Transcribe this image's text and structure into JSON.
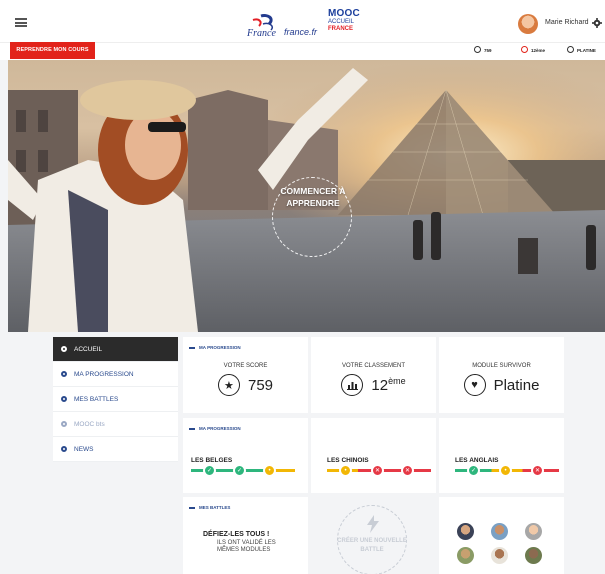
{
  "header": {
    "logo_france_text": "France",
    "logo_france_site": "france.fr",
    "logo_mooc": "MOOC",
    "logo_accueil": "ACCUEIL",
    "logo_country": "FRANCE",
    "user_name": "Marie Richard"
  },
  "subbar": {
    "resume_label": "REPRENDRE MON COURS",
    "stats": [
      {
        "label": "759",
        "icon": "star-icon"
      },
      {
        "label": "12ème",
        "icon": "chart-icon"
      },
      {
        "label": "PLATINE",
        "icon": "heart-icon"
      }
    ]
  },
  "hero": {
    "cta": "COMMENCER À APPRENDRE"
  },
  "sidebar": {
    "items": [
      {
        "label": "ACCUEIL",
        "state": "active"
      },
      {
        "label": "MA PROGRESSION",
        "state": "normal"
      },
      {
        "label": "MES BATTLES",
        "state": "normal"
      },
      {
        "label": "MOOC bts",
        "state": "muted"
      },
      {
        "label": "NEWS",
        "state": "normal"
      }
    ]
  },
  "progress_section": {
    "label": "MA PROGRESSION",
    "cards": [
      {
        "title": "VOTRE SCORE",
        "value": "759",
        "suffix": "",
        "icon": "star-icon"
      },
      {
        "title": "VOTRE CLASSEMENT",
        "value": "12",
        "suffix": "ème",
        "icon": "chart-icon"
      },
      {
        "title": "MODULE SURVIVOR",
        "value": "Platine",
        "suffix": "",
        "icon": "heart-icon"
      }
    ]
  },
  "teams_section": {
    "label": "MA PROGRESSION",
    "teams": [
      {
        "name": "LES BELGES",
        "colors": [
          "#2eb67d",
          "#2eb67d",
          "#f2b705"
        ]
      },
      {
        "name": "LES CHINOIS",
        "colors": [
          "#f2b705",
          "#e63946",
          "#e63946"
        ]
      },
      {
        "name": "LES ANGLAIS",
        "colors": [
          "#2eb67d",
          "#f2b705",
          "#e63946"
        ]
      }
    ]
  },
  "battles_section": {
    "label": "MES BATTLES",
    "title": "DÉFIEZ-LES TOUS !",
    "subtitle": "ILS ONT VALIDÉ LES MÊMES MODULES",
    "create_label": "CRÉER UNE NOUVELLE BATTLE"
  },
  "colors": {
    "accent": "#e2231a",
    "nav": "#2a4a8d",
    "active": "#2b2b2b"
  }
}
